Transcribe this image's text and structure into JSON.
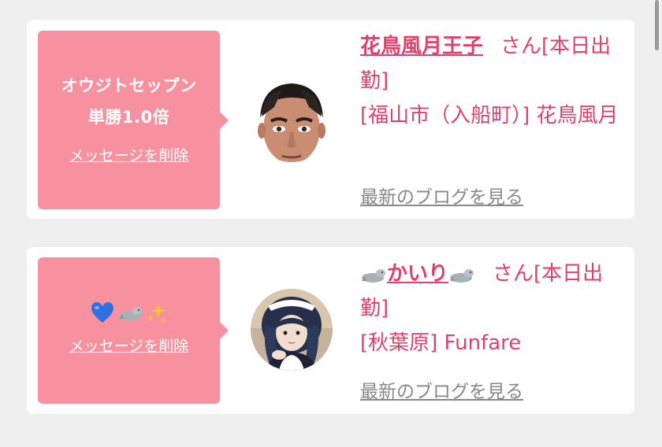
{
  "cards": [
    {
      "message_line1": "オウジトセップン",
      "message_line2": "単勝1.0倍",
      "delete_label": "メッセージを削除",
      "name": "花鳥風月王子",
      "suffix": "さん[本日出勤]",
      "location_line": "[福山市（入船町）] 花鳥風月",
      "blog_link": "最新のブログを見る"
    },
    {
      "message_icons": [
        "blue-heart-icon",
        "seal-icon",
        "sparkles-icon"
      ],
      "delete_label": "メッセージを削除",
      "name": "かいり",
      "name_icons": [
        "seal-icon",
        "seal-icon"
      ],
      "suffix": "さん[本日出勤]",
      "location_line": "[秋葉原] Funfare",
      "blog_link": "最新のブログを見る"
    }
  ],
  "colors": {
    "accent": "#e0406b",
    "message_bg": "#f7919f",
    "card_bg": "#ffffff",
    "page_bg": "#efefef",
    "muted_link": "#888888"
  }
}
